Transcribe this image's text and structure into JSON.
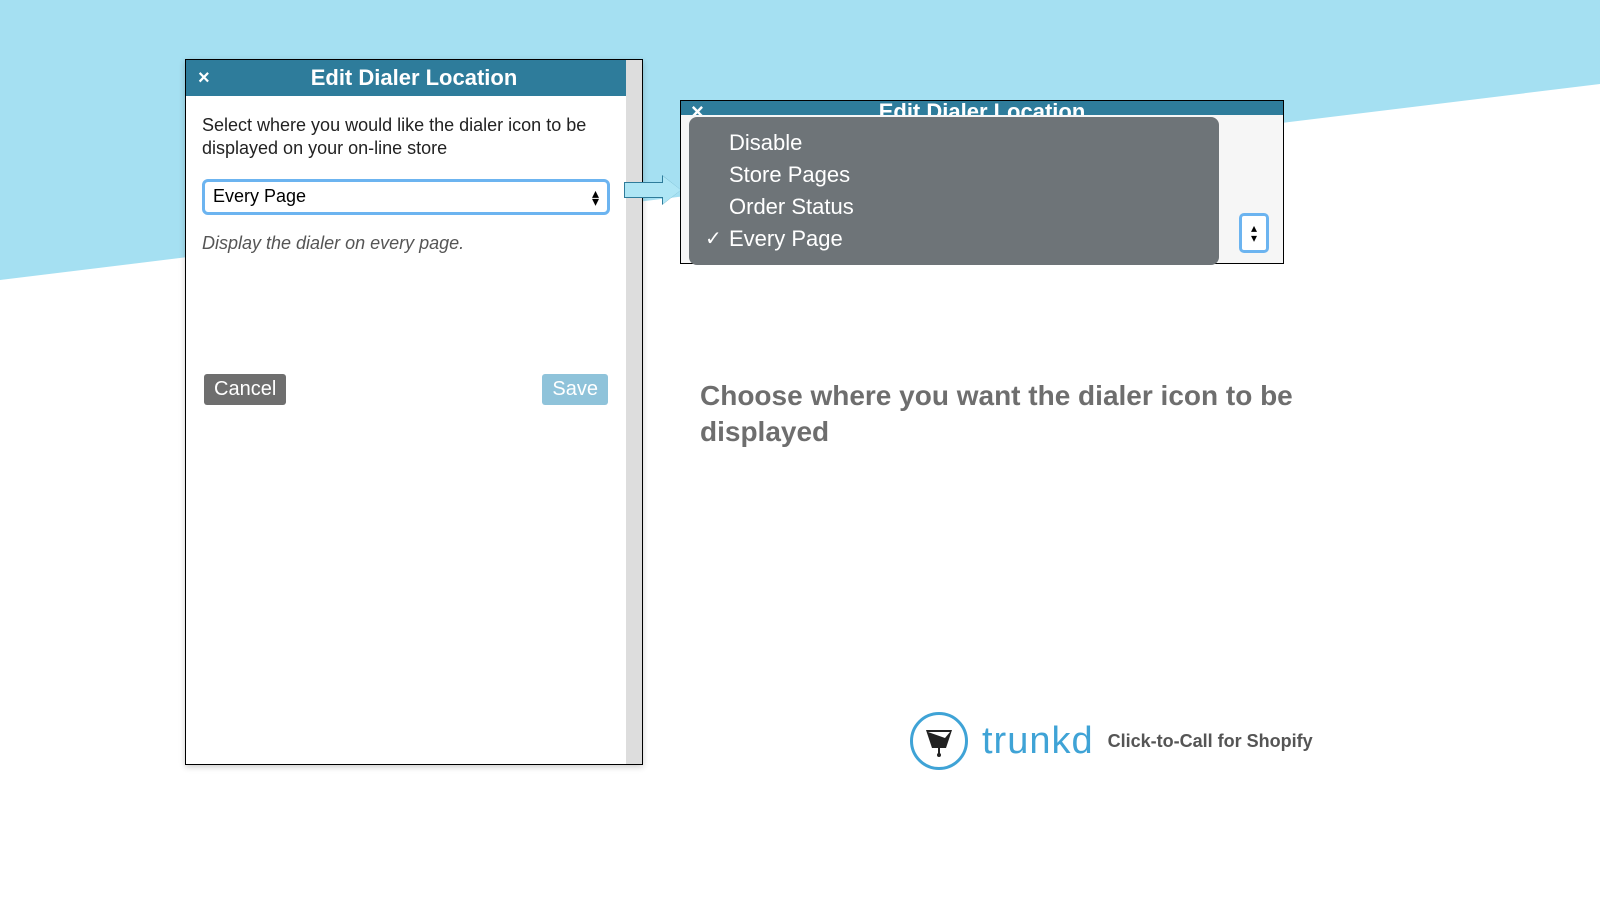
{
  "dialog": {
    "title": "Edit Dialer Location",
    "close_icon": "×",
    "instruction": "Select where you would like the dialer icon to be displayed on your on-line store",
    "select_value": "Every Page",
    "hint": "Display the dialer on every page.",
    "cancel_label": "Cancel",
    "save_label": "Save"
  },
  "dropdown": {
    "title_partial": "Edit Dialer Location",
    "options": [
      "Disable",
      "Store Pages",
      "Order Status",
      "Every Page"
    ],
    "selected_index": 3
  },
  "caption": "Choose where you want the dialer icon to be displayed",
  "brand": {
    "name": "trunkd",
    "tagline": "Click-to-Call for Shopify"
  },
  "colors": {
    "accent_teal": "#2E7C9B",
    "focus_blue": "#6CB4F0",
    "button_save": "#8FC3DA",
    "button_cancel": "#6E6E6E",
    "banner": "#A5E0F2",
    "brand_blue": "#3FA3D6"
  }
}
